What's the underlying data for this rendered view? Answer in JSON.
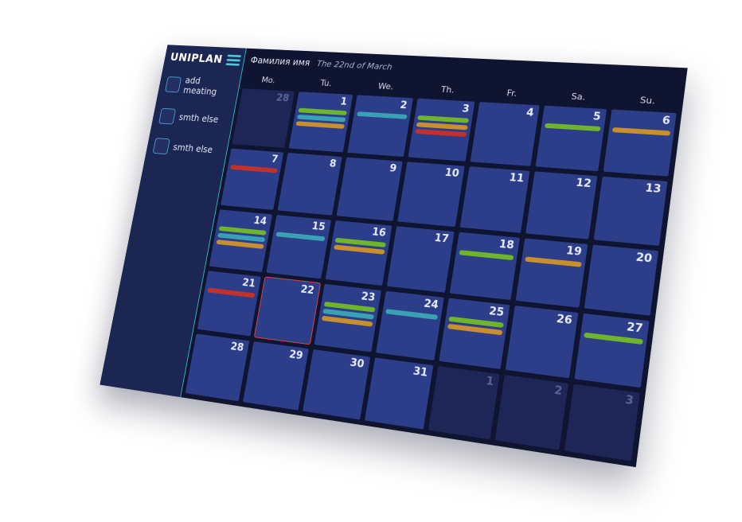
{
  "app": {
    "logo": "UNIPLAN"
  },
  "sidebar": {
    "items": [
      {
        "label": "add meating"
      },
      {
        "label": "smth else"
      },
      {
        "label": "smth else"
      }
    ]
  },
  "header": {
    "user_name": "Фамилия имя",
    "date": "The 22nd of March"
  },
  "calendar": {
    "weekdays": [
      "Mo.",
      "Tu.",
      "We.",
      "Th.",
      "Fr.",
      "Sa.",
      "Su."
    ],
    "colors": {
      "green": "#6fb52c",
      "teal": "#3aa1b5",
      "orange": "#c98e2e",
      "red": "#c2322b"
    },
    "days": [
      {
        "num": "28",
        "muted": true,
        "events": []
      },
      {
        "num": "1",
        "events": [
          "green",
          "teal",
          "orange"
        ]
      },
      {
        "num": "2",
        "events": [
          "teal"
        ]
      },
      {
        "num": "3",
        "events": [
          "green",
          "orange",
          "red"
        ]
      },
      {
        "num": "4",
        "events": []
      },
      {
        "num": "5",
        "events": [
          "green"
        ]
      },
      {
        "num": "6",
        "events": [
          "orange"
        ]
      },
      {
        "num": "7",
        "events": [
          "red"
        ]
      },
      {
        "num": "8",
        "events": []
      },
      {
        "num": "9",
        "events": []
      },
      {
        "num": "10",
        "events": []
      },
      {
        "num": "11",
        "events": []
      },
      {
        "num": "12",
        "events": []
      },
      {
        "num": "13",
        "events": []
      },
      {
        "num": "14",
        "events": [
          "green",
          "teal",
          "orange"
        ]
      },
      {
        "num": "15",
        "events": [
          "teal"
        ]
      },
      {
        "num": "16",
        "events": [
          "green",
          "orange"
        ]
      },
      {
        "num": "17",
        "events": []
      },
      {
        "num": "18",
        "events": [
          "green"
        ]
      },
      {
        "num": "19",
        "events": [
          "orange"
        ]
      },
      {
        "num": "20",
        "events": []
      },
      {
        "num": "21",
        "events": [
          "red"
        ]
      },
      {
        "num": "22",
        "today": true,
        "events": []
      },
      {
        "num": "23",
        "events": [
          "green",
          "teal",
          "orange"
        ]
      },
      {
        "num": "24",
        "events": [
          "teal"
        ]
      },
      {
        "num": "25",
        "events": [
          "green",
          "orange"
        ]
      },
      {
        "num": "26",
        "events": []
      },
      {
        "num": "27",
        "events": [
          "green"
        ]
      },
      {
        "num": "28",
        "events": []
      },
      {
        "num": "29",
        "events": []
      },
      {
        "num": "30",
        "events": []
      },
      {
        "num": "31",
        "events": []
      },
      {
        "num": "1",
        "muted": true,
        "events": []
      },
      {
        "num": "2",
        "muted": true,
        "events": []
      },
      {
        "num": "3",
        "muted": true,
        "events": []
      }
    ]
  }
}
